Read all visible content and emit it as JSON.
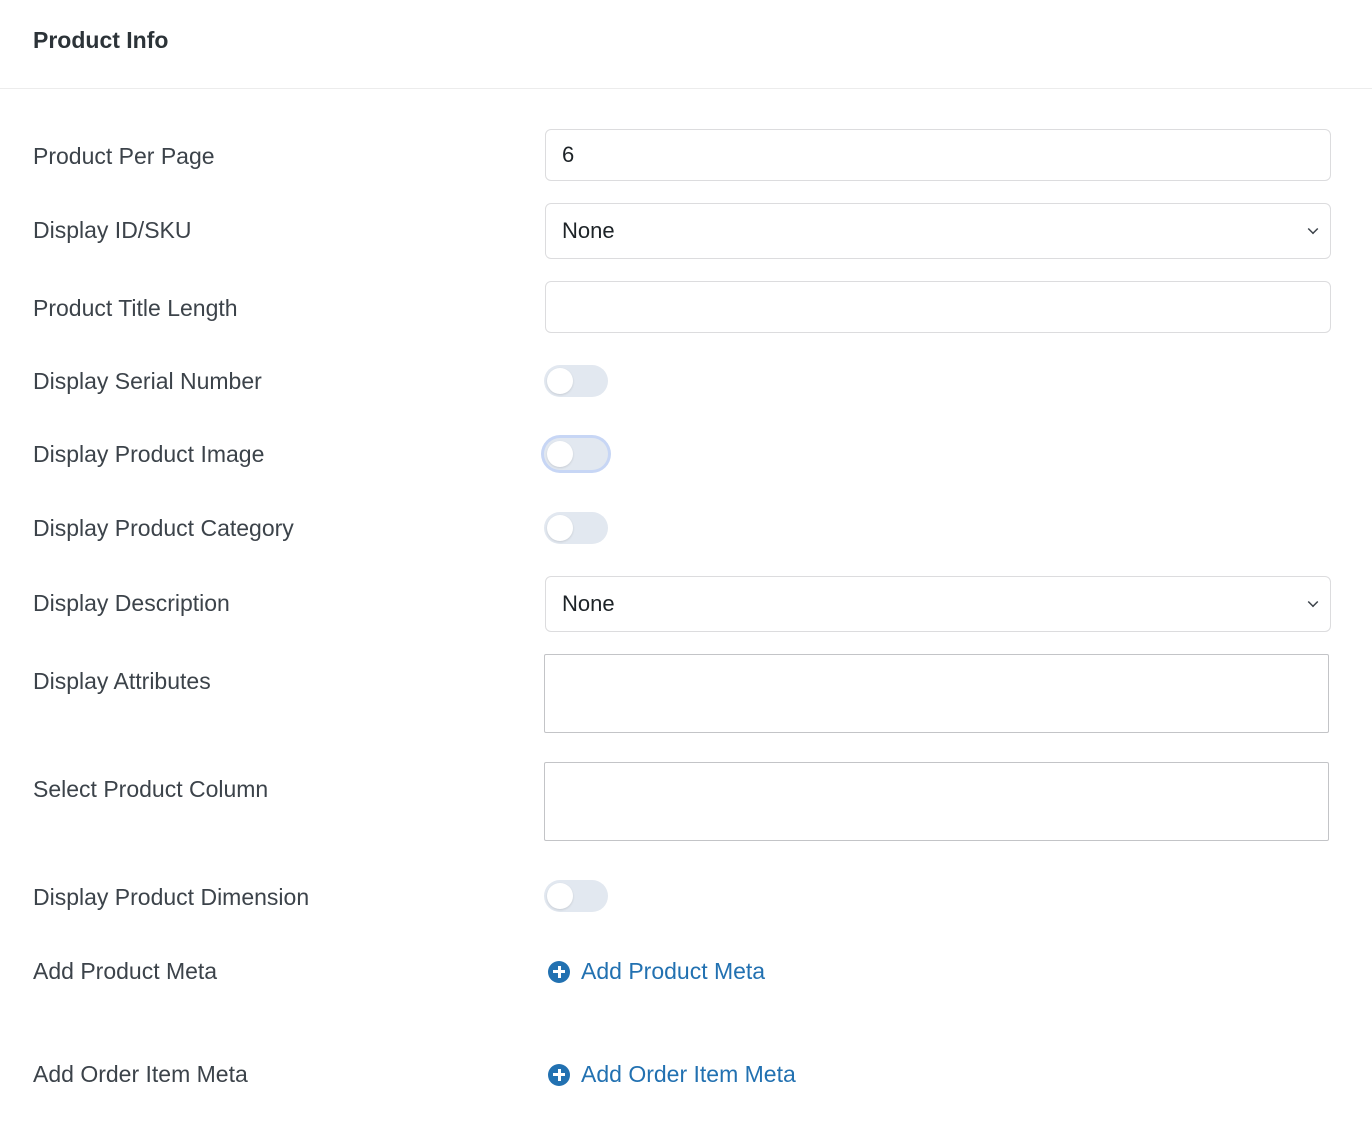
{
  "panel": {
    "title": "Product Info"
  },
  "fields": {
    "product_per_page": {
      "label": "Product Per Page",
      "value": "6"
    },
    "display_id_sku": {
      "label": "Display ID/SKU",
      "selected": "None"
    },
    "product_title_length": {
      "label": "Product Title Length",
      "value": ""
    },
    "display_serial_number": {
      "label": "Display Serial Number",
      "enabled": false
    },
    "display_product_image": {
      "label": "Display Product Image",
      "enabled": false
    },
    "display_product_category": {
      "label": "Display Product Category",
      "enabled": false
    },
    "display_description": {
      "label": "Display Description",
      "selected": "None"
    },
    "display_attributes": {
      "label": "Display Attributes"
    },
    "select_product_column": {
      "label": "Select Product Column"
    },
    "display_product_dimension": {
      "label": "Display Product Dimension",
      "enabled": false
    },
    "add_product_meta": {
      "label": "Add Product Meta",
      "link_label": "Add Product Meta"
    },
    "add_order_item_meta": {
      "label": "Add Order Item Meta",
      "link_label": "Add Order Item Meta"
    }
  },
  "colors": {
    "link": "#2271b1",
    "toggle_off": "#e2e8f0",
    "border": "#dcdcde"
  },
  "icons": {
    "select_arrow": "chevron-down-icon",
    "add": "plus-circle-icon"
  }
}
